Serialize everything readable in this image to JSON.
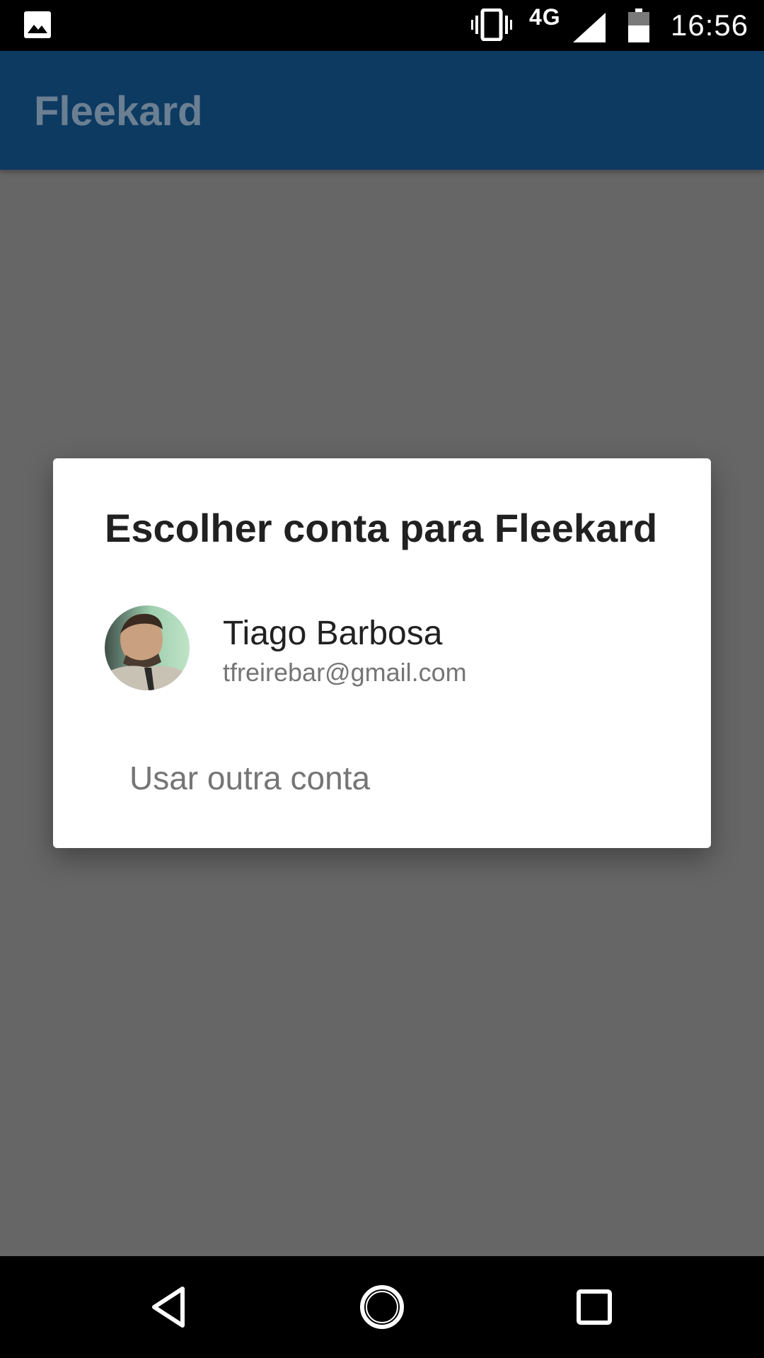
{
  "status_bar": {
    "network_type": "4G",
    "time": "16:56",
    "icons": [
      "gallery-icon",
      "vibrate-icon",
      "signal-icon",
      "battery-icon"
    ]
  },
  "app_bar": {
    "title": "Fleekard",
    "color": "#0d3a61"
  },
  "dialog": {
    "title": "Escolher conta para Fleekard",
    "account": {
      "name": "Tiago Barbosa",
      "email": "tfreirebar@gmail.com"
    },
    "other_account_label": "Usar outra conta"
  },
  "nav_bar": {
    "icons": [
      "back-icon",
      "home-icon",
      "recents-icon"
    ]
  }
}
